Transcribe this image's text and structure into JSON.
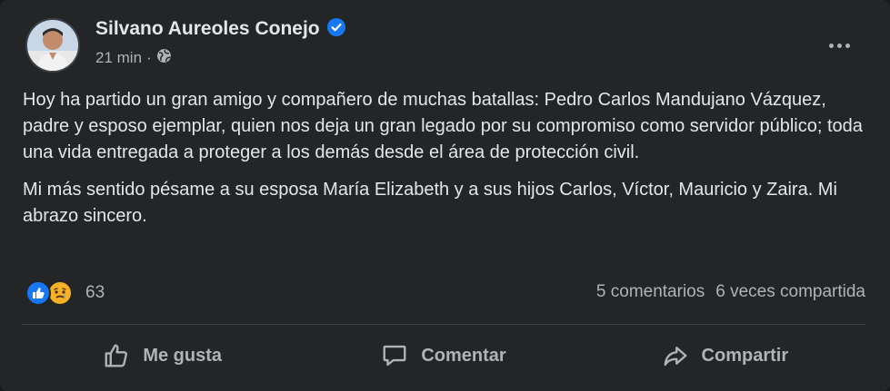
{
  "post": {
    "author": "Silvano Aureoles Conejo",
    "timestamp": "21 min",
    "separator": "·",
    "audience_icon": "globe-icon",
    "verified_icon": "verified-badge-icon",
    "paragraphs": [
      "Hoy ha partido un gran amigo y compañero de muchas batallas: Pedro Carlos Mandujano Vázquez, padre y esposo ejemplar, quien nos deja un gran legado por su compromiso como servidor público; toda una vida entregada a proteger a los demás desde el área de protección civil.",
      "Mi más sentido pésame a su esposa María Elizabeth y a sus hijos Carlos, Víctor, Mauricio y Zaira. Mi abrazo sincero."
    ]
  },
  "stats": {
    "reaction_icons": [
      "like-reaction-icon",
      "sad-reaction-icon"
    ],
    "reaction_count": "63",
    "comments": "5 comentarios",
    "shares": "6 veces compartida"
  },
  "actions": {
    "like_label": "Me gusta",
    "comment_label": "Comentar",
    "share_label": "Compartir"
  },
  "colors": {
    "background": "#242526",
    "text": "#e4e6eb",
    "secondary_text": "#b0b3b8",
    "accent": "#1877f2",
    "sad_reaction": "#f7b125"
  }
}
